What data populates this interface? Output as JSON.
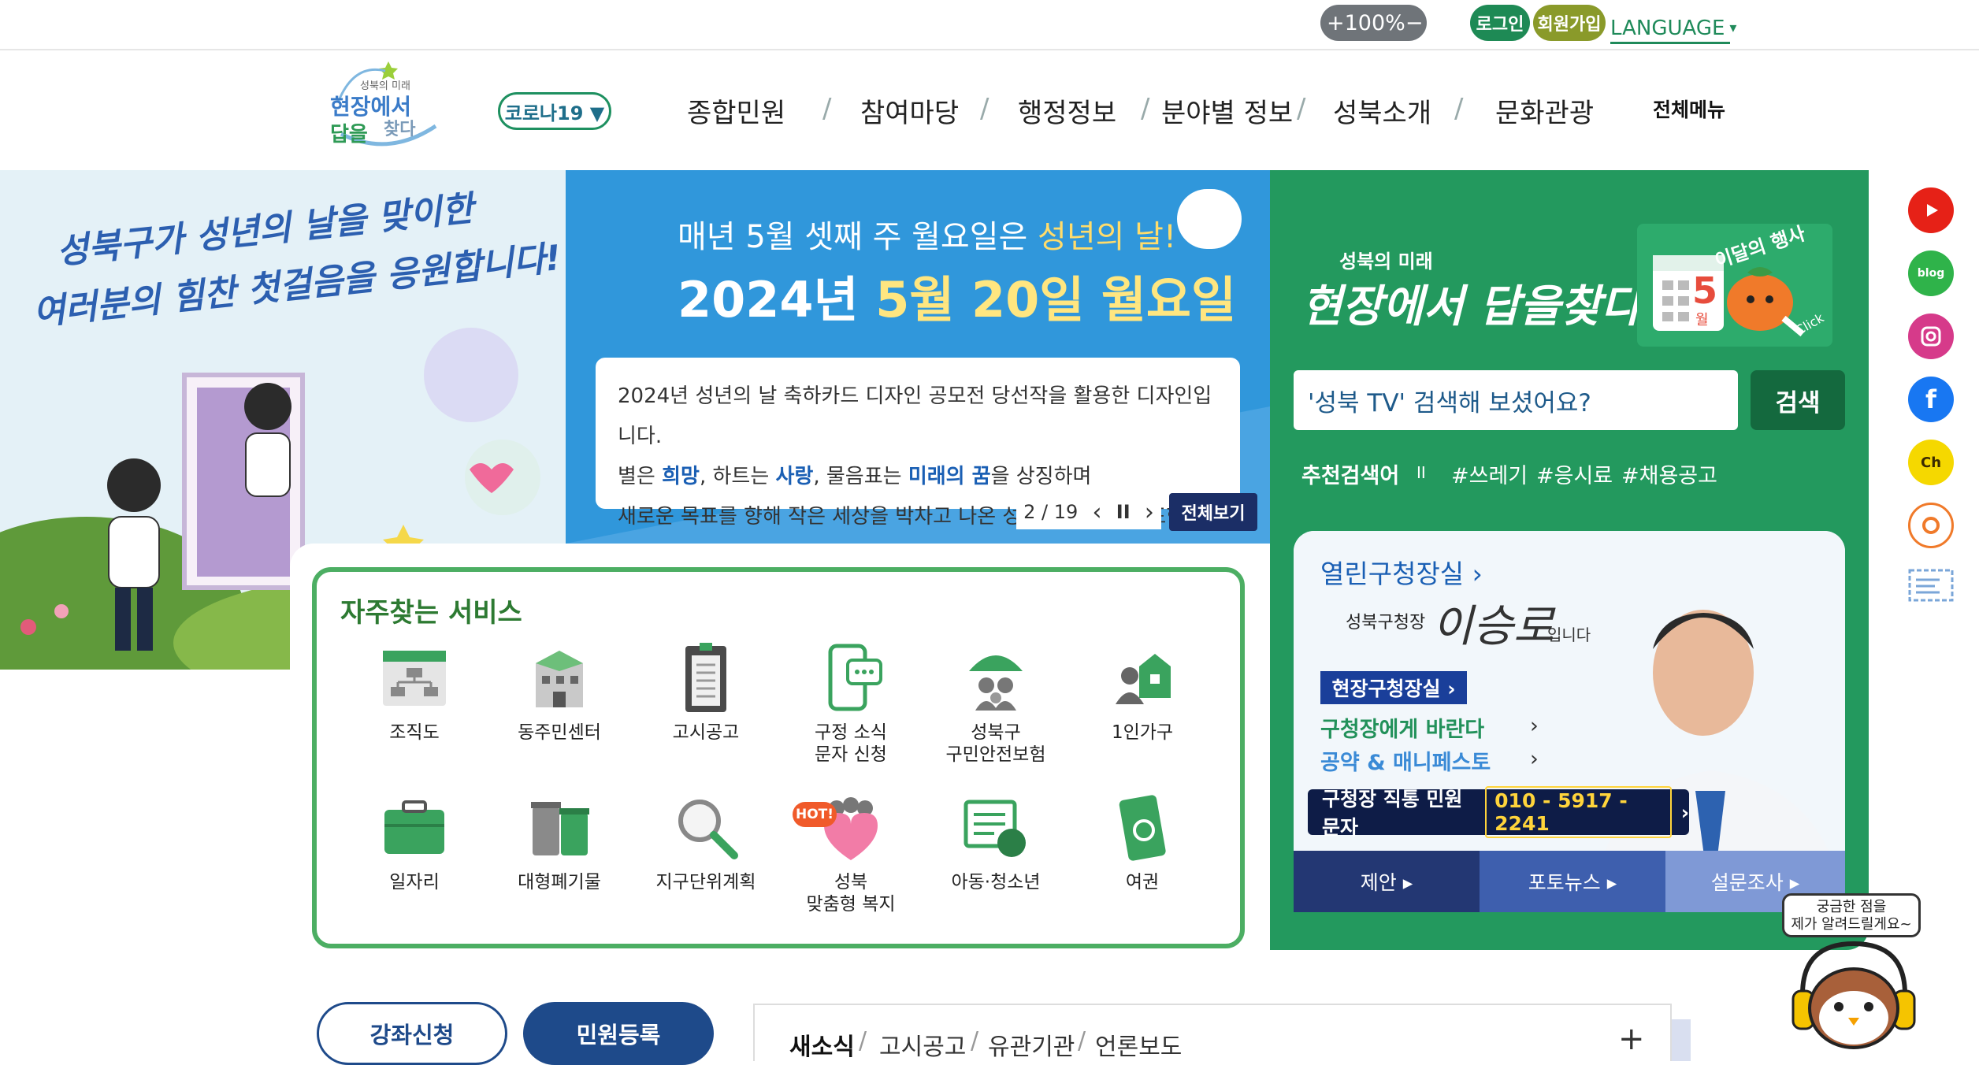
{
  "util": {
    "zoom_plus": "+",
    "zoom_value": "100%",
    "zoom_minus": "−",
    "login": "로그인",
    "signup": "회원가입",
    "language": "LANGUAGE",
    "language_caret": "▾"
  },
  "logo": {
    "small": "성북의 미래",
    "main1": "현장에서",
    "main2": "답을",
    "main3": "찾다"
  },
  "gnb": {
    "covid": "코로나19 ▼",
    "items": [
      "종합민원",
      "참여마당",
      "행정정보",
      "분야별 정보",
      "성북소개",
      "문화관광"
    ],
    "separator": "/",
    "all_menu": "전체메뉴"
  },
  "banner": {
    "left_text1": "성북구가 성년의 날을 맞이한",
    "left_text2": "여러분의 힘찬 첫걸음을 응원합니다!",
    "line1_pre": "매년 5월 셋째 주 월요일은 ",
    "line1_hl": "성년의 날!",
    "line2_pre": "2024년 ",
    "line2_hl1": "5월 20일 ",
    "line2_hl2": "월요일",
    "box_line1": "2024년 성년의 날 축하카드 디자인 공모전 당선작을 활용한 디자인입니다.",
    "box_line2_a": "별은 ",
    "box_line2_b": "희망",
    "box_line2_c": ", 하트는 ",
    "box_line2_d": "사랑",
    "box_line2_e": ", 물음표는 ",
    "box_line2_f": "미래의 꿈",
    "box_line2_g": "을 상징하며",
    "box_line3": "새로운 목표를 향해 작은 세상을 박차고 나온 성년들의 모습을 표현했습니다.",
    "pager_current": "2",
    "pager_sep": "/",
    "pager_total": "19",
    "prev": "‹",
    "pause": "II",
    "next": "›",
    "view_all": "전체보기"
  },
  "green": {
    "slogan_small": "성북의 미래",
    "slogan": "현장에서 답을찾다",
    "event_label": "이달의 행사",
    "event_click": "Click",
    "event_day": "5",
    "event_month": "월",
    "search_placeholder": "'성북 TV' 검색해 보셨어요?",
    "search_button": "검색",
    "rec_label": "추천검색어",
    "rec_pause": "II",
    "rec_items": [
      "#쓰레기",
      "#응시료",
      "#채용공고"
    ]
  },
  "mayor": {
    "title": "열린구청장실 ›",
    "sign_prefix": "성북구청장",
    "name": "이승로",
    "name_suffix": "입니다",
    "field_button": "현장구청장실 ›",
    "link1": "구청장에게 바란다",
    "link2": "공약 & 매니페스토",
    "arrow": "›",
    "sms_label": "구청장 직통 민원문자",
    "sms_number": "010 - 5917 - 2241",
    "sms_arrow": "›",
    "tabs": [
      "제안 ▸",
      "포토뉴스 ▸",
      "설문조사 ▸"
    ]
  },
  "services": {
    "title": "자주찾는 서비스",
    "hot": "HOT!",
    "items": [
      {
        "label": "조직도",
        "label2": ""
      },
      {
        "label": "동주민센터",
        "label2": ""
      },
      {
        "label": "고시공고",
        "label2": ""
      },
      {
        "label": "구정 소식",
        "label2": "문자 신청"
      },
      {
        "label": "성북구",
        "label2": "구민안전보험"
      },
      {
        "label": "1인가구",
        "label2": ""
      },
      {
        "label": "일자리",
        "label2": ""
      },
      {
        "label": "대형폐기물",
        "label2": ""
      },
      {
        "label": "지구단위계획",
        "label2": ""
      },
      {
        "label": "성북",
        "label2": "맞춤형 복지"
      },
      {
        "label": "아동·청소년",
        "label2": ""
      },
      {
        "label": "여권",
        "label2": ""
      }
    ]
  },
  "bottom": {
    "lecture": "강좌신청",
    "civil": "민원등록",
    "news_tabs": [
      "새소식",
      "고시공고",
      "유관기관",
      "언론보도"
    ],
    "news_sep": "/",
    "plus": "+"
  },
  "chatbot": {
    "line1": "궁금한 점을",
    "line2": "제가 알려드릴게요~"
  },
  "sns": {
    "blog": "blog",
    "ch": "Ch"
  },
  "colors": {
    "green_panel": "#23995e",
    "banner_blue": "#2f8ed6",
    "navy": "#1b2e66",
    "service_border": "#4cae63"
  }
}
